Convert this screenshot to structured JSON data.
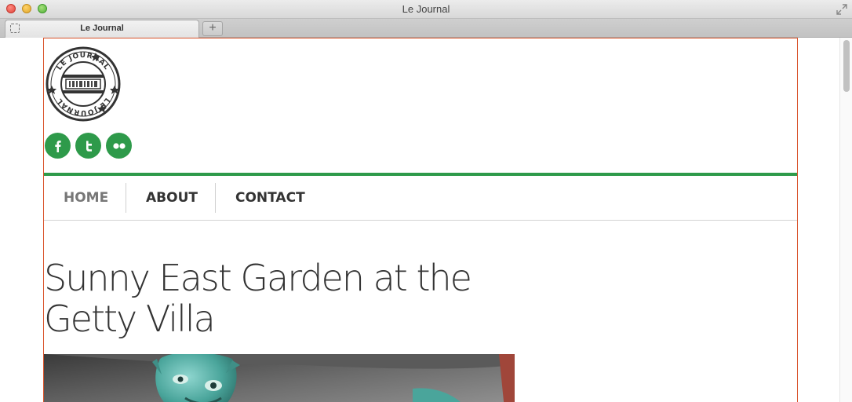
{
  "window": {
    "title": "Le Journal",
    "tab_label": "Le Journal",
    "new_tab_label": "+"
  },
  "site": {
    "logo_text": "LE JOURNAL",
    "social": [
      "facebook-icon",
      "twitter-icon",
      "flickr-icon"
    ],
    "accent_color": "#2e9a4a"
  },
  "nav": {
    "items": [
      {
        "label": "HOME",
        "active": true
      },
      {
        "label": "ABOUT",
        "active": false
      },
      {
        "label": "CONTACT",
        "active": false
      }
    ]
  },
  "post": {
    "title": "Sunny East Garden at the Getty Villa"
  }
}
